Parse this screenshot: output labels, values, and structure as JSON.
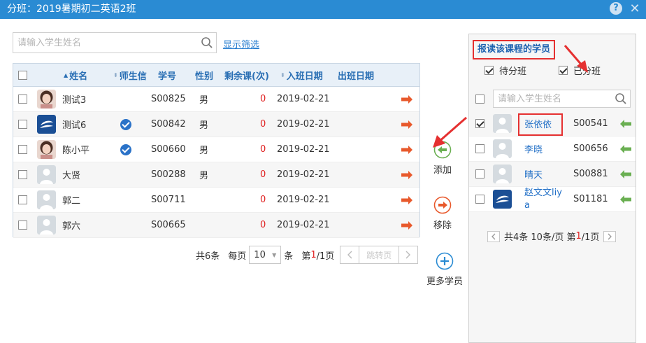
{
  "window": {
    "title": "分班：2019暑期初二英语2班",
    "help": "?",
    "close": "✕"
  },
  "search": {
    "placeholder": "请输入学生姓名",
    "filter_link": "显示筛选"
  },
  "table": {
    "headers": {
      "name": "姓名",
      "teacher_msg": "师生信",
      "student_no": "学号",
      "gender": "性别",
      "remaining": "剩余课(次)",
      "join_date": "入班日期",
      "leave_date": "出班日期"
    },
    "rows": [
      {
        "name": "测试3",
        "avatar": "photo-girl",
        "verified": false,
        "student_no": "S00825",
        "gender": "男",
        "remaining": "0",
        "join_date": "2019-02-21"
      },
      {
        "name": "测试6",
        "avatar": "logo-blue",
        "verified": true,
        "student_no": "S00842",
        "gender": "男",
        "remaining": "0",
        "join_date": "2019-02-21"
      },
      {
        "name": "陈小平",
        "avatar": "photo-girl",
        "verified": true,
        "student_no": "S00660",
        "gender": "男",
        "remaining": "0",
        "join_date": "2019-02-21"
      },
      {
        "name": "大贤",
        "avatar": "default-person",
        "verified": false,
        "student_no": "S00288",
        "gender": "男",
        "remaining": "0",
        "join_date": "2019-02-21"
      },
      {
        "name": "郭二",
        "avatar": "default-person",
        "verified": false,
        "student_no": "S00711",
        "gender": "",
        "remaining": "0",
        "join_date": "2019-02-21"
      },
      {
        "name": "郭六",
        "avatar": "default-person",
        "verified": false,
        "student_no": "S00665",
        "gender": "",
        "remaining": "0",
        "join_date": "2019-02-21"
      }
    ]
  },
  "pager": {
    "total": "共6条",
    "per_page_label": "每页",
    "per_page_value": "10",
    "unit": "条",
    "page_prefix": "第",
    "page_current": "1",
    "page_suffix": "/1页",
    "jump": "跳转页"
  },
  "actions": {
    "add": "添加",
    "remove": "移除",
    "more": "更多学员"
  },
  "right": {
    "title": "报读该课程的学员",
    "opt_pending": "待分班",
    "opt_assigned": "已分班",
    "search_placeholder": "请输入学生姓名",
    "rows": [
      {
        "name": "张依依",
        "avatar": "default-person",
        "student_no": "S00541",
        "checked": true
      },
      {
        "name": "李晓",
        "avatar": "default-person",
        "student_no": "S00656",
        "checked": false
      },
      {
        "name": "晴天",
        "avatar": "default-person",
        "student_no": "S00881",
        "checked": false
      },
      {
        "name": "赵文文liya",
        "avatar": "logo-blue",
        "student_no": "S01181",
        "checked": false
      }
    ],
    "pager": {
      "text_a": "共4条 10条/页 第",
      "page_current": "1",
      "text_b": "/1页"
    }
  },
  "colors": {
    "titlebar": "#2a8bd3",
    "accent_link": "#2a7fd0",
    "zero": "#e02020",
    "arrow_right": "#e8592c",
    "arrow_left": "#6aaf52",
    "annotation": "#e53030"
  }
}
